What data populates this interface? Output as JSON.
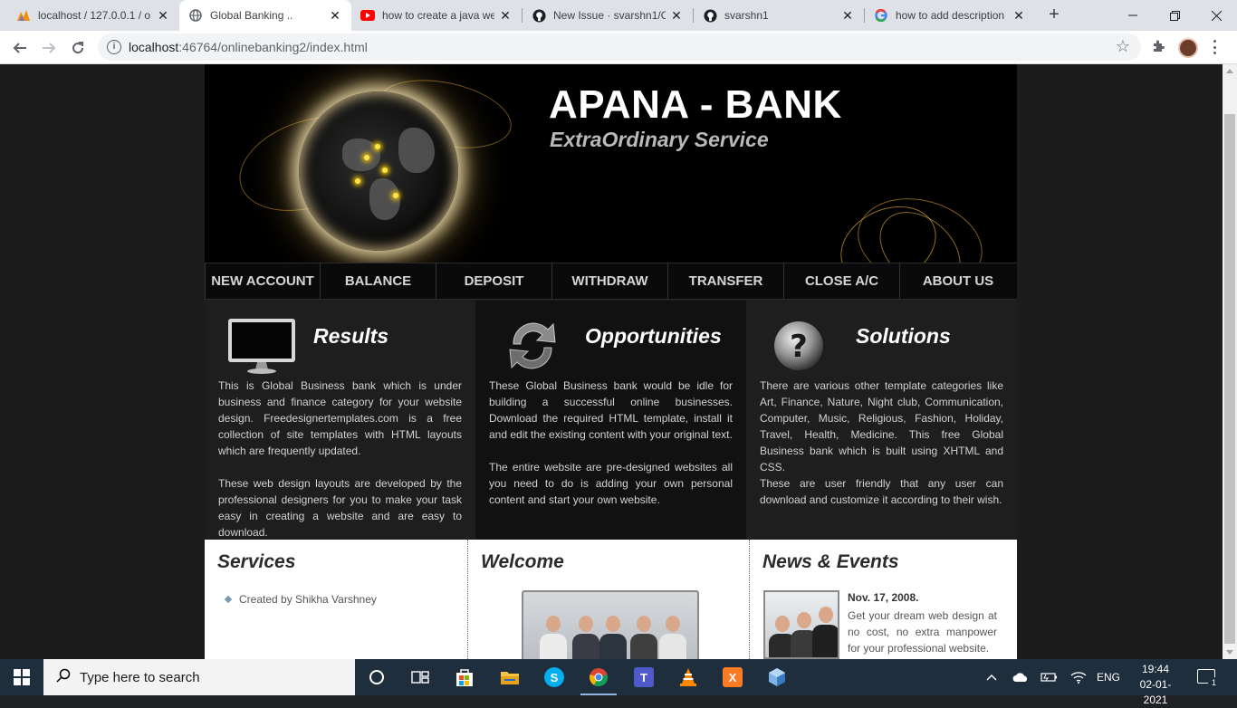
{
  "browser": {
    "tabs": [
      {
        "title": "localhost / 127.0.0.1 / o",
        "icon": "phpmyadmin-icon"
      },
      {
        "title": "Global Banking ..",
        "icon": "globe-icon",
        "active": true
      },
      {
        "title": "how to create a java we",
        "icon": "youtube-icon"
      },
      {
        "title": "New Issue · svarshn1/O",
        "icon": "github-icon"
      },
      {
        "title": "svarshn1",
        "icon": "github-icon"
      },
      {
        "title": "how to add description",
        "icon": "google-icon"
      }
    ],
    "close_glyph": "✕",
    "new_tab_glyph": "+",
    "url_host": "localhost",
    "url_rest": ":46764/onlinebanking2/index.html"
  },
  "banner": {
    "title": "APANA - BANK",
    "tagline": "ExtraOrdinary Service"
  },
  "nav": [
    "NEW ACCOUNT",
    "BALANCE",
    "DEPOSIT",
    "WITHDRAW",
    "TRANSFER",
    "CLOSE A/C",
    "ABOUT US"
  ],
  "columns": [
    {
      "title": "Results",
      "icon": "monitor-icon",
      "paragraphs": [
        "This is Global Business bank which is under business and finance category for your website design. Freedesignertemplates.com is a free collection of site templates with HTML layouts which are frequently updated.",
        "These web design layouts are developed by the professional designers for you to make your task easy in creating a website and are easy to download."
      ]
    },
    {
      "title": "Opportunities",
      "icon": "refresh-arrows-icon",
      "paragraphs": [
        "These Global Business bank would be idle for building a successful online businesses. Download the required HTML template, install it and edit the existing content with your original text.",
        "The entire website are pre-designed websites all you need to do is adding your own personal content and start your own website."
      ]
    },
    {
      "title": "Solutions",
      "icon": "question-icon",
      "paragraphs": [
        "There are various other template categories like Art, Finance, Nature, Night club, Communication, Computer, Music, Religious, Fashion, Holiday, Travel, Health, Medicine. This free Global Business bank which is built using XHTML and CSS.",
        "These are user friendly that any user can download and customize it according to their wish."
      ]
    }
  ],
  "services": {
    "title": "Services",
    "items": [
      "Created by Shikha Varshney"
    ]
  },
  "welcome": {
    "title": "Welcome"
  },
  "news": {
    "title": "News & Events",
    "date": "Nov. 17, 2008.",
    "body": "Get your dream web design at no cost, no extra manpower for your professional website."
  },
  "taskbar": {
    "search_placeholder": "Type here to search",
    "language": "ENG",
    "time": "19:44",
    "date": "02-01-2021",
    "notification_count": "1"
  }
}
